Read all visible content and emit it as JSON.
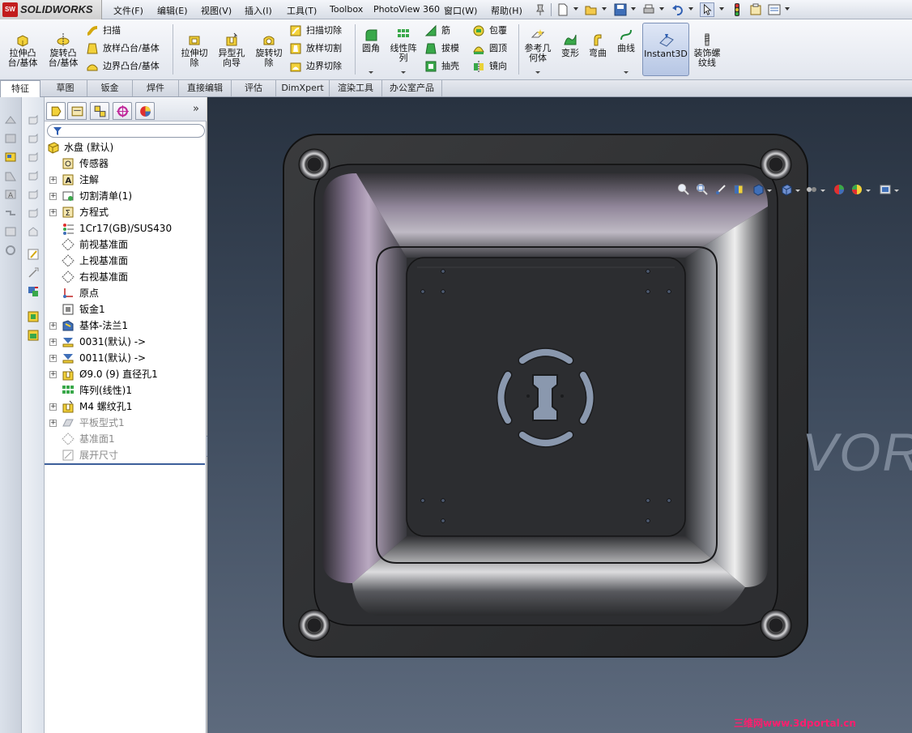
{
  "app": {
    "logo_badge": "SW",
    "logo_text": "SOLIDWORKS"
  },
  "menu": [
    "文件(F)",
    "编辑(E)",
    "视图(V)",
    "插入(I)",
    "工具(T)",
    "Toolbox",
    "PhotoView 360",
    "窗口(W)",
    "帮助(H)"
  ],
  "ribbon": {
    "extrude_boss": "拉伸凸\n台/基体",
    "revolve_boss": "旋转凸\n台/基体",
    "sweep": "扫描",
    "loft_boss": "放样凸台/基体",
    "boundary_boss": "边界凸台/基体",
    "extrude_cut": "拉伸切\n除",
    "hole_wizard": "异型孔\n向导",
    "revolve_cut": "旋转切\n除",
    "swept_cut": "扫描切除",
    "lofted_cut": "放样切割",
    "boundary_cut": "边界切除",
    "fillet": "圆角",
    "linear_pattern": "线性阵\n列",
    "rib": "筋",
    "draft": "拔模",
    "shell": "抽壳",
    "wrap": "包覆",
    "dome": "圆顶",
    "mirror": "镜向",
    "ref_geometry": "参考几\n何体",
    "deform": "变形",
    "flex": "弯曲",
    "curves": "曲线",
    "instant3d": "Instant3D",
    "cosmetic_thread": "装饰螺\n纹线"
  },
  "tabs": [
    "特征",
    "草图",
    "钣金",
    "焊件",
    "直接编辑",
    "评估",
    "DimXpert",
    "渲染工具",
    "办公室产品"
  ],
  "tree": {
    "root": "水盘 (默认)",
    "items": [
      {
        "label": "传感器",
        "expandable": false,
        "dim": false
      },
      {
        "label": "注解",
        "expandable": true,
        "dim": false
      },
      {
        "label": "切割清单(1)",
        "expandable": true,
        "dim": false
      },
      {
        "label": "方程式",
        "expandable": true,
        "dim": false
      },
      {
        "label": "1Cr17(GB)/SUS430",
        "expandable": false,
        "dim": false
      },
      {
        "label": "前视基准面",
        "expandable": false,
        "dim": false
      },
      {
        "label": "上视基准面",
        "expandable": false,
        "dim": false
      },
      {
        "label": "右视基准面",
        "expandable": false,
        "dim": false
      },
      {
        "label": "原点",
        "expandable": false,
        "dim": false
      },
      {
        "label": "钣金1",
        "expandable": false,
        "dim": false
      },
      {
        "label": "基体-法兰1",
        "expandable": true,
        "dim": false
      },
      {
        "label": "0031(默认) ->",
        "expandable": true,
        "dim": false
      },
      {
        "label": "0011(默认) ->",
        "expandable": true,
        "dim": false
      },
      {
        "label": "Ø9.0 (9) 直径孔1",
        "expandable": true,
        "dim": false
      },
      {
        "label": "阵列(线性)1",
        "expandable": false,
        "dim": false
      },
      {
        "label": "M4 螺纹孔1",
        "expandable": true,
        "dim": false
      },
      {
        "label": "平板型式1",
        "expandable": true,
        "dim": true
      },
      {
        "label": "基准面1",
        "expandable": false,
        "dim": true
      },
      {
        "label": "展开尺寸",
        "expandable": false,
        "dim": true
      }
    ]
  },
  "viewport": {
    "watermark": "VOR",
    "site_watermark": "三维网www.3dportal.cn"
  },
  "colors": {
    "accent": "#3d5f9a",
    "viewport_top": "#283240",
    "viewport_bottom": "#5d6a7d",
    "part": "#2b2c2e"
  }
}
